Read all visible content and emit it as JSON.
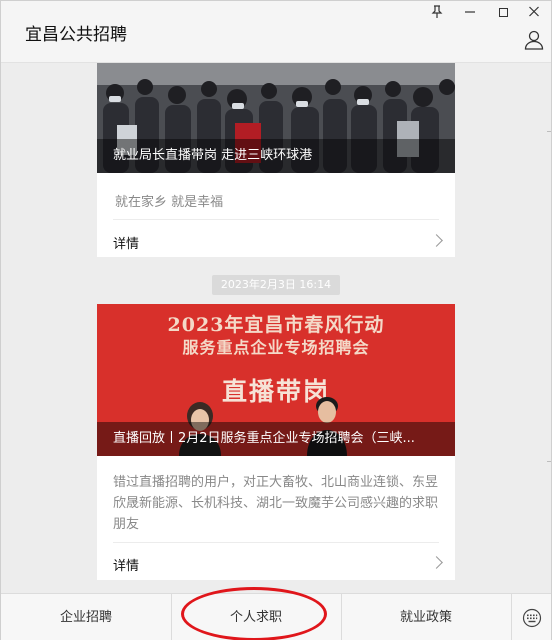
{
  "window": {
    "title": "宜昌公共招聘",
    "controls": {
      "pin": "pin-icon",
      "minimize": "minimize-icon",
      "maximize": "maximize-icon",
      "close": "close-icon",
      "profile": "person-icon"
    }
  },
  "articles": [
    {
      "caption": "就业局长直播带岗 走进三峡环球港",
      "description": "就在家乡 就是幸福",
      "detail_label": "详情"
    },
    {
      "banner_line1": "2023年宜昌市春风行动",
      "banner_line2": "服务重点企业专场招聘会",
      "banner_big": "直播带岗",
      "caption": "直播回放丨2月2日服务重点企业专场招聘会（三峡...",
      "description": "错过直播招聘的用户，对正大畜牧、北山商业连锁、东昱欣晟新能源、长机科技、湖北一致魔芋公司感兴趣的求职朋友",
      "detail_label": "详情"
    }
  ],
  "timestamp": "2023年2月3日  16:14",
  "menu": {
    "items": [
      "企业招聘",
      "个人求职",
      "就业政策"
    ],
    "keyboard_icon": "keyboard-icon",
    "highlight_color": "#e0161b"
  }
}
